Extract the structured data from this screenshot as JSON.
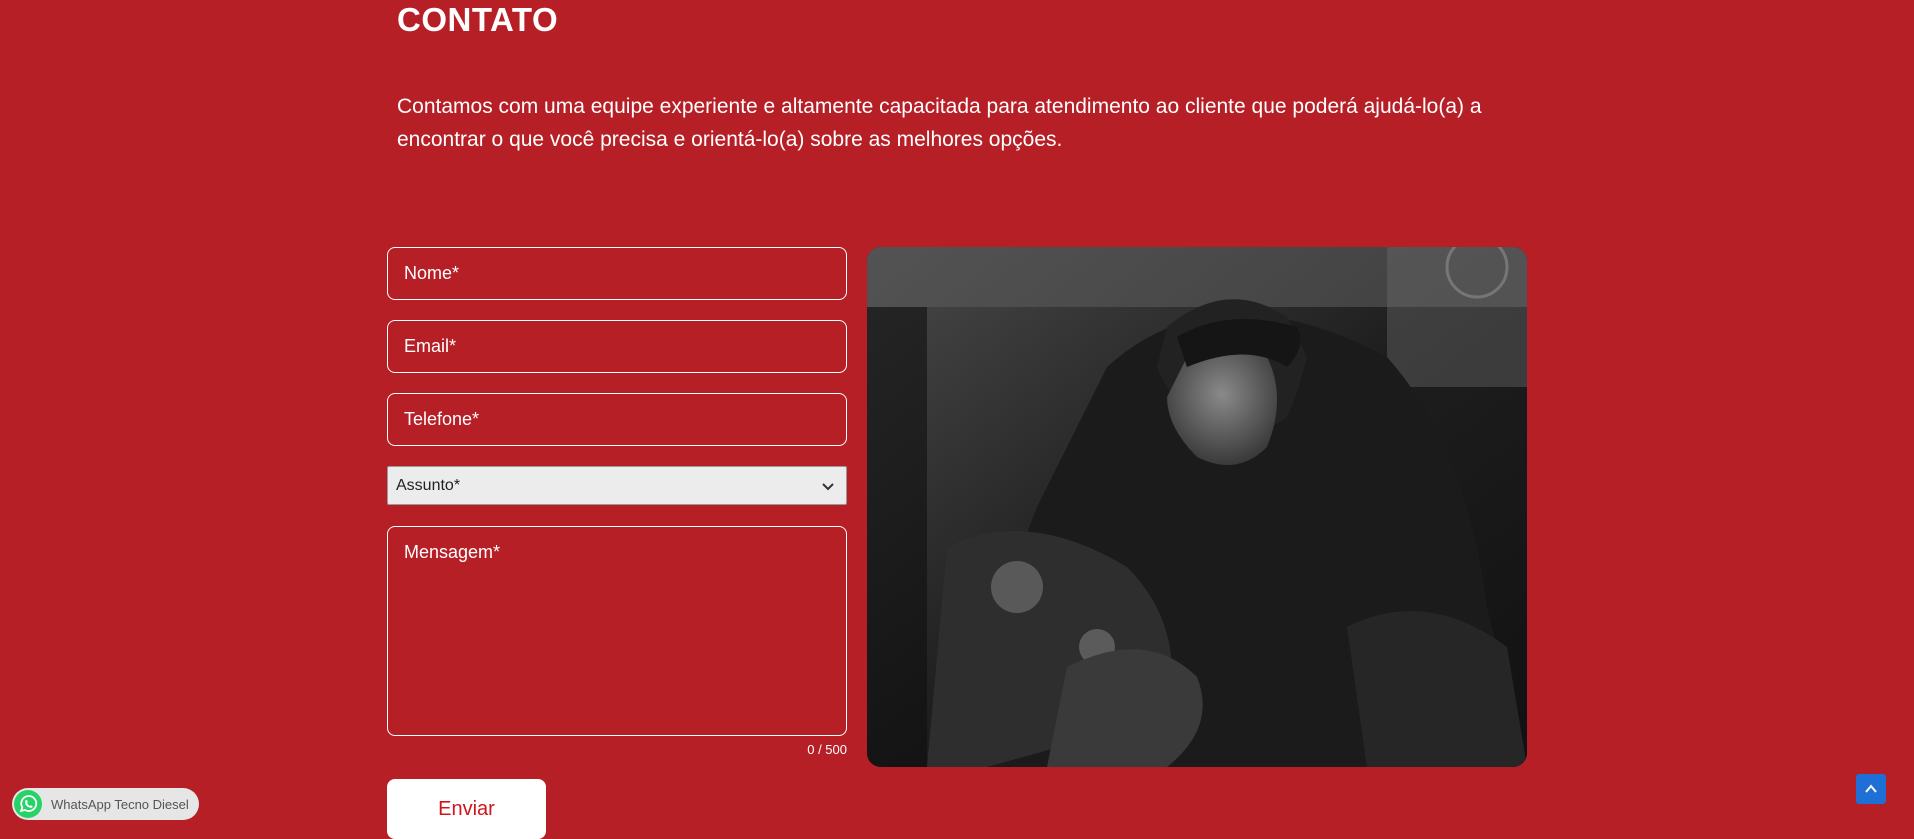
{
  "section": {
    "title": "CONTATO",
    "description": "Contamos com uma equipe experiente e altamente capacitada para atendimento ao cliente que poderá ajudá-lo(a) a encontrar o que você precisa e orientá-lo(a) sobre as melhores opções."
  },
  "form": {
    "name_placeholder": "Nome*",
    "email_placeholder": "Email*",
    "phone_placeholder": "Telefone*",
    "subject_selected": "Assunto*",
    "message_placeholder": "Mensagem*",
    "char_counter": "0 / 500",
    "submit_label": "Enviar"
  },
  "image": {
    "description_icon": "mechanic-photo"
  },
  "whatsapp": {
    "label": "WhatsApp Tecno Diesel",
    "icon": "whatsapp-icon"
  },
  "scroll_top": {
    "icon": "chevron-up-icon"
  },
  "colors": {
    "background": "#b71f27",
    "button_text": "#d0141c",
    "scroll_top_bg": "#1e6fd6"
  }
}
